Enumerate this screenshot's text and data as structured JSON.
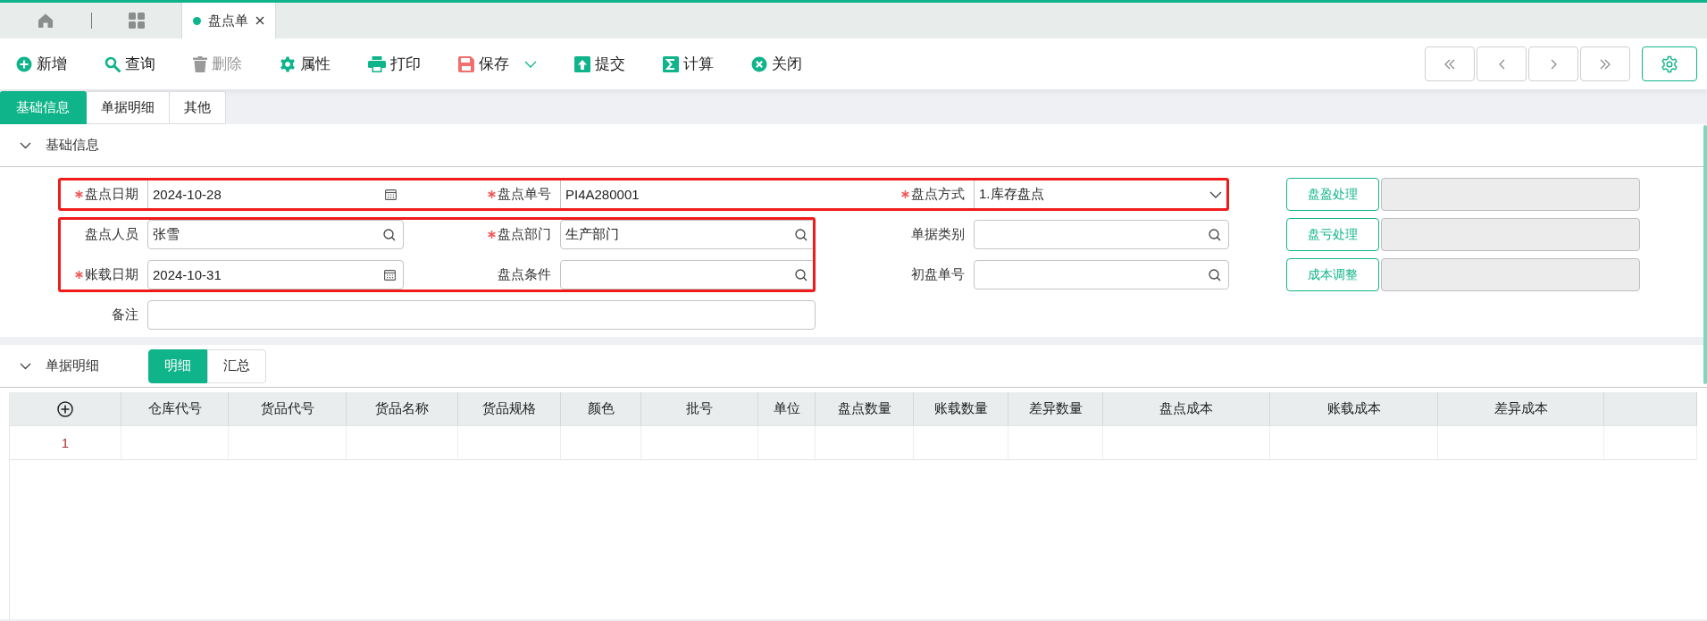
{
  "tabs": [
    {
      "kind": "home",
      "selected": false
    },
    {
      "kind": "apps",
      "selected": false
    },
    {
      "kind": "document",
      "label": "盘点单",
      "selected": true,
      "closable": true
    }
  ],
  "toolbar": [
    {
      "kind": "add",
      "label": "新增",
      "disabled": false
    },
    {
      "kind": "query",
      "label": "查询",
      "disabled": false
    },
    {
      "kind": "delete",
      "label": "删除",
      "disabled": true
    },
    {
      "kind": "properties",
      "label": "属性",
      "disabled": false
    },
    {
      "kind": "print",
      "label": "打印",
      "disabled": false
    },
    {
      "kind": "save",
      "label": "保存",
      "disabled": false,
      "dropdown": true
    },
    {
      "kind": "submit",
      "label": "提交",
      "disabled": false
    },
    {
      "kind": "calculate",
      "label": "计算",
      "disabled": false
    },
    {
      "kind": "close",
      "label": "关闭",
      "disabled": false
    }
  ],
  "navigation": [
    {
      "kind": "first"
    },
    {
      "kind": "previous"
    },
    {
      "kind": "next"
    },
    {
      "kind": "last"
    },
    {
      "kind": "settings"
    }
  ],
  "page_tabs": [
    {
      "label": "基础信息",
      "selected": true
    },
    {
      "label": "单据明细",
      "selected": false
    },
    {
      "label": "其他",
      "selected": false
    }
  ],
  "basic_info": {
    "title": "基础信息",
    "expanded": true,
    "fields": [
      {
        "label": "盘点日期",
        "required": true,
        "kind": "date",
        "value": "2024-10-28"
      },
      {
        "label": "盘点单号",
        "required": true,
        "kind": "text",
        "value": "PI4A280001"
      },
      {
        "label": "盘点方式",
        "required": true,
        "kind": "select",
        "value": "1.库存盘点"
      },
      {
        "label": "盘点人员",
        "required": false,
        "kind": "lookup",
        "value": "张雪"
      },
      {
        "label": "盘点部门",
        "required": true,
        "kind": "lookup",
        "value": "生产部门"
      },
      {
        "label": "单据类别",
        "required": false,
        "kind": "lookup"
      },
      {
        "label": "账载日期",
        "required": true,
        "kind": "date",
        "value": "2024-10-31"
      },
      {
        "label": "盘点条件",
        "required": false,
        "kind": "lookup"
      },
      {
        "label": "初盘单号",
        "required": false,
        "kind": "lookup"
      },
      {
        "label": "备注",
        "required": false,
        "kind": "text"
      }
    ],
    "actions": [
      {
        "label": "盘盈处理"
      },
      {
        "label": "盘亏处理"
      },
      {
        "label": "成本调整"
      }
    ]
  },
  "detail": {
    "title": "单据明细",
    "expanded": true,
    "views": [
      {
        "label": "明细",
        "selected": true
      },
      {
        "label": "汇总",
        "selected": false
      }
    ],
    "table": {
      "columns": [
        "仓库代号",
        "货品代号",
        "货品名称",
        "货品规格",
        "颜色",
        "批号",
        "单位",
        "盘点数量",
        "账载数量",
        "差异数量",
        "盘点成本",
        "账载成本",
        "差异成本"
      ],
      "rows": [
        {
          "number": "1"
        }
      ]
    }
  }
}
